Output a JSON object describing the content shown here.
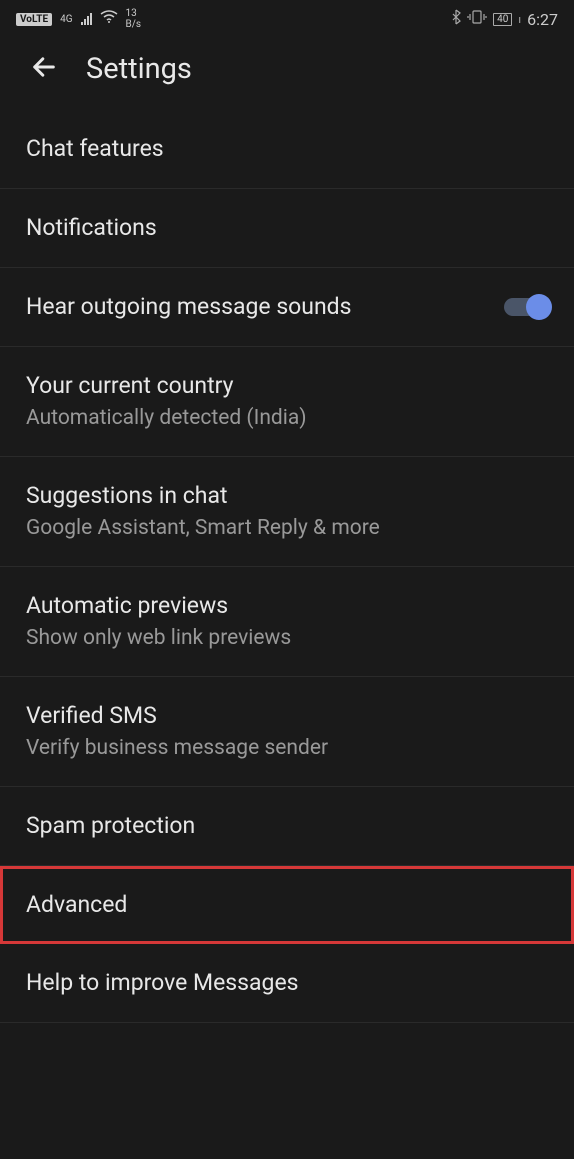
{
  "statusBar": {
    "volte": "VoLTE",
    "netType": "4G",
    "dataRate1": "13",
    "dataRate2": "B/s",
    "battery": "40",
    "time": "6:27"
  },
  "header": {
    "title": "Settings"
  },
  "items": [
    {
      "title": "Chat features",
      "subtitle": null,
      "toggle": false,
      "highlight": false
    },
    {
      "title": "Notifications",
      "subtitle": null,
      "toggle": false,
      "highlight": false
    },
    {
      "title": "Hear outgoing message sounds",
      "subtitle": null,
      "toggle": true,
      "highlight": false
    },
    {
      "title": "Your current country",
      "subtitle": "Automatically detected (India)",
      "toggle": false,
      "highlight": false
    },
    {
      "title": "Suggestions in chat",
      "subtitle": "Google Assistant, Smart Reply & more",
      "toggle": false,
      "highlight": false
    },
    {
      "title": "Automatic previews",
      "subtitle": "Show only web link previews",
      "toggle": false,
      "highlight": false
    },
    {
      "title": "Verified SMS",
      "subtitle": "Verify business message sender",
      "toggle": false,
      "highlight": false
    },
    {
      "title": "Spam protection",
      "subtitle": null,
      "toggle": false,
      "highlight": false
    },
    {
      "title": "Advanced",
      "subtitle": null,
      "toggle": false,
      "highlight": true
    },
    {
      "title": "Help to improve Messages",
      "subtitle": null,
      "toggle": false,
      "highlight": false
    }
  ]
}
